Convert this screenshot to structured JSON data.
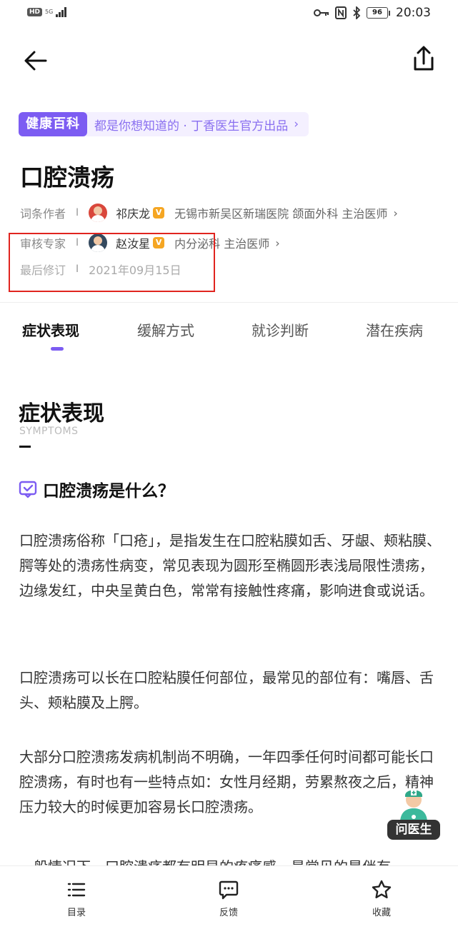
{
  "status_bar": {
    "left_badge": "HD",
    "network": "5G",
    "time": "20:03",
    "battery": "96"
  },
  "banner": {
    "tag": "健康百科",
    "text": "都是你想知道的 · 丁香医生官方出品"
  },
  "title": "口腔溃疡",
  "meta": {
    "author_label": "词条作者",
    "author_name": "祁庆龙",
    "author_detail": "无锡市新吴区新瑞医院 颌面外科 主治医师",
    "reviewer_label": "审核专家",
    "reviewer_name": "赵汝星",
    "reviewer_detail": "内分泌科 主治医师",
    "revised_label": "最后修订",
    "revised_date": "2021年09月15日",
    "separator": "I"
  },
  "tabs": [
    "症状表现",
    "缓解方式",
    "就诊判断",
    "潜在疾病"
  ],
  "section": {
    "title": "症状表现",
    "subtitle": "SYMPTOMS",
    "question": "口腔溃疡是什么？",
    "paragraphs": [
      "口腔溃疡俗称「口疮」，是指发生在口腔粘膜如舌、牙龈、颊粘膜、腭等处的溃疡性病变，常见表现为圆形至椭圆形表浅局限性溃疡，边缘发红，中央呈黄白色，常常有接触性疼痛，影响进食或说话。",
      "口腔溃疡可以长在口腔粘膜任何部位，最常见的部位有：嘴唇、舌头、颊粘膜及上腭。",
      "大部分口腔溃疡发病机制尚不明确，一年四季任何时间都可能长口腔溃疡，有时也有一些特点如：女性月经期，劳累熬夜之后，精神压力较大的时候更加容易长口腔溃疡。",
      "一般情况下，口腔溃疡都有明显的疼痛感，最常见的是伴有"
    ]
  },
  "ask_doctor": "问医生",
  "bottom_bar": {
    "toc": "目录",
    "feedback": "反馈",
    "favorite": "收藏"
  },
  "colors": {
    "accent": "#7c5cf2",
    "highlight": "#e0241f",
    "verify": "#f5a623"
  }
}
